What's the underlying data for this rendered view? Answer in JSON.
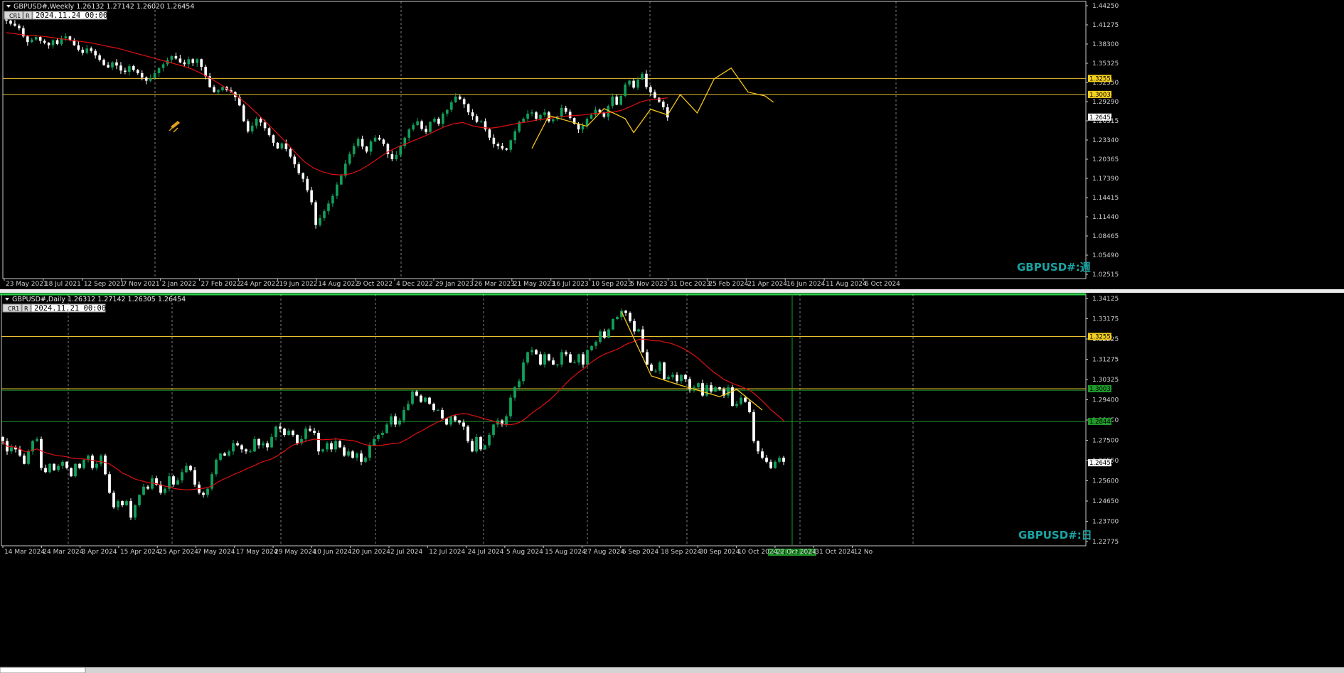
{
  "colors": {
    "background": "#000000",
    "frame": "#c8c8c8",
    "grid": "#c8c8c8",
    "bull": "#11a05a",
    "bear": "#ffffff",
    "ma": "#e01010",
    "zigzag": "#f5c518",
    "hline_yellow": "#e8c030",
    "hline_green": "#1e9a2a",
    "watermark": "#1aa3a3",
    "active_border": "#2fd04a"
  },
  "panels": [
    {
      "id": "weekly",
      "header": "GBPUSD#,Weekly  1.26132 1.27142 1.26020 1.26454",
      "buttons": [
        "CR1",
        "R"
      ],
      "datetime": "2024.11.24 00:00",
      "watermark": "GBPUSD#:週",
      "active": false
    },
    {
      "id": "daily",
      "header": "GBPUSD#,Daily  1.26312 1.27142 1.26305 1.26454",
      "buttons": [
        "CR1",
        "R"
      ],
      "datetime": "2024.11.21 00:00",
      "watermark": "GBPUSD#:日",
      "active": true
    }
  ],
  "chart_data": [
    {
      "type": "candlestick",
      "symbol": "GBPUSD#",
      "timeframe": "Weekly",
      "ohlc_last": {
        "open": 1.26132,
        "high": 1.27142,
        "low": 1.2602,
        "close": 1.26454
      },
      "ylim": [
        1.00945,
        1.44725
      ],
      "y_ticks": [
        "1.44250",
        "1.41275",
        "1.38300",
        "1.35325",
        "1.32350",
        "1.29290",
        "1.26315",
        "1.23340",
        "1.20365",
        "1.17390",
        "1.14415",
        "1.11440",
        "1.08465",
        "1.05490",
        "1.02515"
      ],
      "x_tick_labels": [
        "23 May 2021",
        "18 Jul 2021",
        "12 Sep 2021",
        "7 Nov 2021",
        "2 Jan 2022",
        "27 Feb 2022",
        "24 Apr 2022",
        "19 Jun 2022",
        "14 Aug 2022",
        "9 Oct 2022",
        "4 Dec 2022",
        "29 Jan 2023",
        "26 Mar 2023",
        "21 May 2023",
        "16 Jul 2023",
        "10 Sep 2023",
        "5 Nov 2023",
        "31 Dec 2023",
        "25 Feb 2024",
        "21 Apr 2024",
        "16 Jun 2024",
        "11 Aug 2024",
        "6 Oct 2024"
      ],
      "price_labels": [
        {
          "text": "1.32557",
          "value": 1.32557,
          "bg": "#f5d020",
          "fg": "#000000"
        },
        {
          "text": "1.30033",
          "value": 1.30033,
          "bg": "#f5d020",
          "fg": "#000000"
        },
        {
          "text": "1.26454",
          "value": 1.26454,
          "bg": "#ffffff",
          "fg": "#000000"
        }
      ],
      "horizontal_lines": [
        {
          "value": 1.32557,
          "color": "#e8c030"
        },
        {
          "value": 1.30033,
          "color": "#e8c030"
        }
      ],
      "close_series": [
        1.417,
        1.412,
        1.409,
        1.405,
        1.392,
        1.383,
        1.387,
        1.391,
        1.385,
        1.382,
        1.378,
        1.386,
        1.38,
        1.389,
        1.392,
        1.386,
        1.378,
        1.371,
        1.366,
        1.373,
        1.369,
        1.362,
        1.355,
        1.347,
        1.343,
        1.351,
        1.346,
        1.338,
        1.336,
        1.345,
        1.339,
        1.334,
        1.327,
        1.322,
        1.326,
        1.334,
        1.342,
        1.348,
        1.355,
        1.361,
        1.357,
        1.351,
        1.348,
        1.356,
        1.35,
        1.356,
        1.344,
        1.329,
        1.312,
        1.304,
        1.307,
        1.312,
        1.307,
        1.304,
        1.296,
        1.283,
        1.258,
        1.242,
        1.251,
        1.262,
        1.256,
        1.247,
        1.236,
        1.224,
        1.215,
        1.223,
        1.214,
        1.202,
        1.19,
        1.176,
        1.167,
        1.149,
        1.13,
        1.094,
        1.105,
        1.116,
        1.128,
        1.14,
        1.158,
        1.172,
        1.191,
        1.206,
        1.219,
        1.23,
        1.218,
        1.21,
        1.226,
        1.232,
        1.229,
        1.222,
        1.206,
        1.198,
        1.205,
        1.219,
        1.232,
        1.245,
        1.252,
        1.258,
        1.246,
        1.241,
        1.257,
        1.262,
        1.254,
        1.27,
        1.276,
        1.288,
        1.297,
        1.293,
        1.285,
        1.272,
        1.266,
        1.257,
        1.258,
        1.245,
        1.232,
        1.222,
        1.219,
        1.215,
        1.213,
        1.228,
        1.242,
        1.257,
        1.262,
        1.27,
        1.272,
        1.262,
        1.268,
        1.272,
        1.258,
        1.261,
        1.266,
        1.279,
        1.273,
        1.263,
        1.254,
        1.245,
        1.251,
        1.262,
        1.268,
        1.276,
        1.272,
        1.265,
        1.282,
        1.297,
        1.284,
        1.298,
        1.316,
        1.322,
        1.311,
        1.324,
        1.333,
        1.312,
        1.304,
        1.295,
        1.289,
        1.28,
        1.264
      ],
      "ma_series": [
        1.398,
        1.396,
        1.394,
        1.393,
        1.392,
        1.39,
        1.388,
        1.386,
        1.384,
        1.382,
        1.379,
        1.376,
        1.373,
        1.369,
        1.365,
        1.361,
        1.357,
        1.353,
        1.349,
        1.345,
        1.34,
        1.333,
        1.325,
        1.316,
        1.306,
        1.295,
        1.283,
        1.269,
        1.255,
        1.24,
        1.225,
        1.209,
        1.194,
        1.184,
        1.178,
        1.174,
        1.173,
        1.175,
        1.181,
        1.19,
        1.2,
        1.21,
        1.217,
        1.223,
        1.229,
        1.235,
        1.242,
        1.249,
        1.254,
        1.256,
        1.251,
        1.248,
        1.247,
        1.249,
        1.252,
        1.255,
        1.257,
        1.26,
        1.262,
        1.264,
        1.266,
        1.267,
        1.268,
        1.27,
        1.271,
        1.272,
        1.275,
        1.281,
        1.288,
        1.292,
        1.293,
        1.295
      ],
      "zigzag": [
        {
          "i": 124,
          "v": 1.215
        },
        {
          "i": 128,
          "v": 1.267
        },
        {
          "i": 137,
          "v": 1.25
        },
        {
          "i": 141,
          "v": 1.278
        },
        {
          "i": 146,
          "v": 1.262
        },
        {
          "i": 148,
          "v": 1.24
        },
        {
          "i": 152,
          "v": 1.277
        },
        {
          "i": 156,
          "v": 1.268
        },
        {
          "i": 159,
          "v": 1.3
        },
        {
          "i": 163,
          "v": 1.271
        },
        {
          "i": 167,
          "v": 1.325
        },
        {
          "i": 171,
          "v": 1.342
        },
        {
          "i": 175,
          "v": 1.304
        },
        {
          "i": 179,
          "v": 1.298
        },
        {
          "i": 181,
          "v": 1.288
        }
      ]
    },
    {
      "type": "candlestick",
      "symbol": "GBPUSD#",
      "timeframe": "Daily",
      "ohlc_last": {
        "open": 1.26312,
        "high": 1.27142,
        "low": 1.26305,
        "close": 1.26454
      },
      "ylim": [
        1.2244,
        1.346
      ],
      "y_ticks": [
        "1.34125",
        "1.33175",
        "1.32225",
        "1.31275",
        "1.30325",
        "1.29400",
        "1.28450",
        "1.27500",
        "1.26550",
        "1.25600",
        "1.24650",
        "1.23700",
        "1.22775"
      ],
      "x_tick_labels": [
        "14 Mar 2024",
        "24 Mar 2024",
        "3 Apr 2024",
        "15 Apr 2024",
        "25 Apr 2024",
        "7 May 2024",
        "17 May 2024",
        "29 May 2024",
        "10 Jun 2024",
        "20 Jun 2024",
        "2 Jul 2024",
        "12 Jul 2024",
        "24 Jul 2024",
        "5 Aug 2024",
        "15 Aug 2024",
        "27 Aug 2024",
        "6 Sep 2024",
        "18 Sep 2024",
        "30 Sep 2024",
        "10 Oct 2024",
        "22 Oct 2024",
        "31 Oct 2024",
        "12 No"
      ],
      "crosshair_label": "2024.11.22 00:00",
      "price_labels": [
        {
          "text": "1.32557",
          "value": 1.32557,
          "bg": "#f5d020",
          "fg": "#000000"
        },
        {
          "text": "1.30033",
          "value": 1.30033,
          "bg": "#1e9a2a",
          "fg": "#000000"
        },
        {
          "text": "1.28448",
          "value": 1.28448,
          "bg": "#1e9a2a",
          "fg": "#000000"
        },
        {
          "text": "1.26454",
          "value": 1.26454,
          "bg": "#ffffff",
          "fg": "#000000"
        }
      ],
      "horizontal_lines": [
        {
          "value": 1.32557,
          "color": "#e8c030"
        },
        {
          "value": 1.30033,
          "color": "#e8c030"
        },
        {
          "value": 1.2996,
          "color": "#1e9a2a"
        },
        {
          "value": 1.28448,
          "color": "#1e9a2a"
        }
      ],
      "close_series": [
        1.275,
        1.27,
        1.272,
        1.271,
        1.268,
        1.264,
        1.27,
        1.275,
        1.276,
        1.262,
        1.26,
        1.264,
        1.261,
        1.263,
        1.265,
        1.262,
        1.258,
        1.264,
        1.262,
        1.266,
        1.268,
        1.262,
        1.264,
        1.268,
        1.259,
        1.25,
        1.243,
        1.246,
        1.244,
        1.246,
        1.238,
        1.244,
        1.249,
        1.253,
        1.252,
        1.257,
        1.254,
        1.25,
        1.252,
        1.258,
        1.254,
        1.256,
        1.26,
        1.263,
        1.261,
        1.254,
        1.25,
        1.249,
        1.252,
        1.259,
        1.266,
        1.269,
        1.268,
        1.27,
        1.274,
        1.273,
        1.271,
        1.27,
        1.27,
        1.276,
        1.273,
        1.274,
        1.272,
        1.277,
        1.282,
        1.281,
        1.278,
        1.28,
        1.278,
        1.274,
        1.276,
        1.281,
        1.28,
        1.279,
        1.27,
        1.271,
        1.274,
        1.271,
        1.275,
        1.272,
        1.268,
        1.27,
        1.267,
        1.269,
        1.265,
        1.267,
        1.273,
        1.276,
        1.278,
        1.279,
        1.283,
        1.287,
        1.283,
        1.285,
        1.29,
        1.293,
        1.299,
        1.297,
        1.294,
        1.296,
        1.293,
        1.29,
        1.29,
        1.286,
        1.283,
        1.287,
        1.285,
        1.284,
        1.282,
        1.275,
        1.27,
        1.277,
        1.271,
        1.273,
        1.278,
        1.283,
        1.285,
        1.283,
        1.287,
        1.296,
        1.301,
        1.304,
        1.313,
        1.318,
        1.319,
        1.317,
        1.312,
        1.317,
        1.314,
        1.312,
        1.312,
        1.318,
        1.317,
        1.313,
        1.313,
        1.317,
        1.312,
        1.319,
        1.321,
        1.323,
        1.328,
        1.325,
        1.329,
        1.334,
        1.335,
        1.338,
        1.337,
        1.333,
        1.328,
        1.329,
        1.318,
        1.312,
        1.309,
        1.309,
        1.313,
        1.305,
        1.306,
        1.307,
        1.304,
        1.307,
        1.305,
        1.3,
        1.301,
        1.303,
        1.297,
        1.302,
        1.299,
        1.301,
        1.3,
        1.297,
        1.301,
        1.292,
        1.293,
        1.296,
        1.294,
        1.289,
        1.275,
        1.27,
        1.267,
        1.265,
        1.262,
        1.265,
        1.267,
        1.265
      ]
    }
  ]
}
